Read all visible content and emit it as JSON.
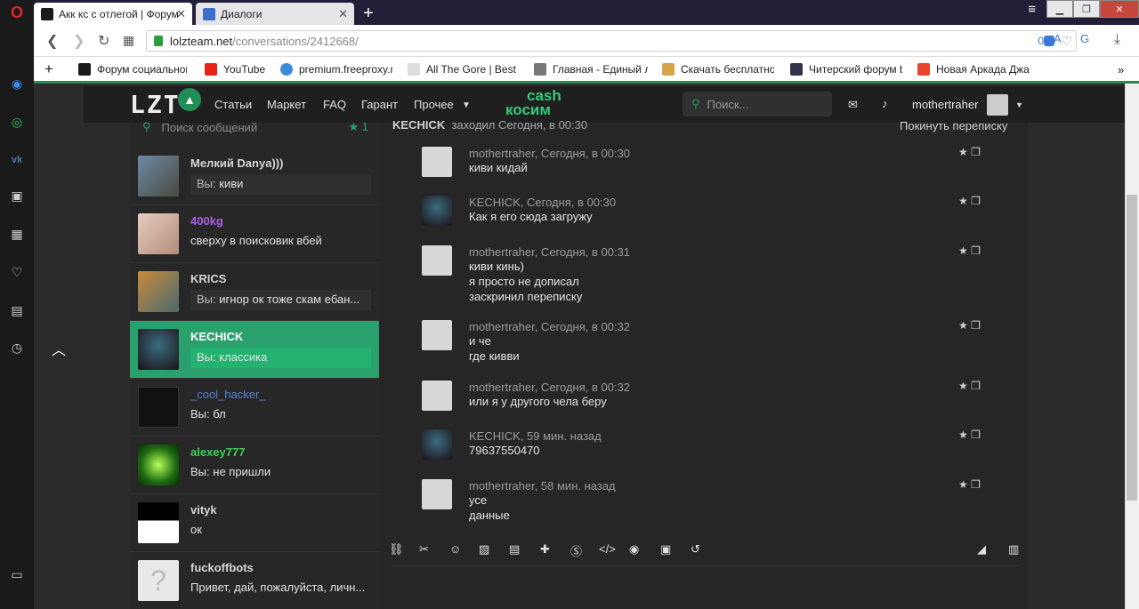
{
  "browser": {
    "tabs": [
      {
        "title": "Акк кс с отлегой | Форум"
      },
      {
        "title": "Диалоги"
      }
    ],
    "address": {
      "domain": "lolzteam.net",
      "path": "/conversations/2412668/",
      "badge_count": "0"
    },
    "bookmarks": [
      {
        "label": "Форум социальной"
      },
      {
        "label": "YouTube"
      },
      {
        "label": "premium.freeproxy.r"
      },
      {
        "label": "All The Gore | Best G"
      },
      {
        "label": "Главная - Единый л"
      },
      {
        "label": "Скачать бесплатно"
      },
      {
        "label": "Читерский форум b"
      },
      {
        "label": "Новая Аркада Джа"
      }
    ]
  },
  "site": {
    "logo": "LZT",
    "nav": [
      "Статьи",
      "Маркет",
      "FAQ",
      "Гарант",
      "Прочее"
    ],
    "cash_logo": [
      "cash",
      "косим"
    ],
    "search_placeholder": "Поиск...",
    "username": "mothertraher"
  },
  "conversations": {
    "search_placeholder": "Поиск сообщений",
    "items": [
      {
        "name": "Мелкий Danya)))",
        "preview_prefix": "Вы:",
        "preview": "киви",
        "name_color": "#d6d6d6"
      },
      {
        "name": "400kg",
        "preview_prefix": "",
        "preview": "сверху в поисковик вбей",
        "name_color": "#b15de6"
      },
      {
        "name": "KRICS",
        "preview_prefix": "Вы:",
        "preview": "игнор ок тоже скам ебан...",
        "name_color": "#d6d6d6"
      },
      {
        "name": "KECHICK",
        "preview_prefix": "Вы:",
        "preview": "классика",
        "name_color": "#ffffff"
      },
      {
        "name": "_cool_hacker_",
        "preview_prefix": "Вы:",
        "preview": "бл",
        "name_color": "#5a7fd0"
      },
      {
        "name": "alexey777",
        "preview_prefix": "Вы:",
        "preview": "не пришли",
        "name_color": "#3fd05a"
      },
      {
        "name": "vityk",
        "preview_prefix": "",
        "preview": "ок",
        "name_color": "#d6d6d6"
      },
      {
        "name": "fuckoffbots",
        "preview_prefix": "",
        "preview": "Привет, дай, пожалуйста, личн...",
        "name_color": "#d6d6d6"
      }
    ]
  },
  "dialog": {
    "partner": "KECHICK",
    "status": "заходил Сегодня, в 00:30",
    "leave_label": "Покинуть переписку",
    "messages": [
      {
        "meta": "mothertraher, Сегодня, в 00:30",
        "lines": [
          "киви кидай"
        ],
        "author": "me"
      },
      {
        "meta": "KECHICK, Сегодня, в 00:30",
        "lines": [
          "Как я его сюда загружу"
        ],
        "author": "them"
      },
      {
        "meta": "mothertraher, Сегодня, в 00:31",
        "lines": [
          "киви кинь)",
          "я просто не дописал",
          "заскринил переписку"
        ],
        "author": "me"
      },
      {
        "meta": "mothertraher, Сегодня, в 00:32",
        "lines": [
          "и че",
          "где кивви"
        ],
        "author": "me"
      },
      {
        "meta": "mothertraher, Сегодня, в 00:32",
        "lines": [
          "или я у другого чела беру"
        ],
        "author": "me"
      },
      {
        "meta": "KECHICK, 59 мин. назад",
        "lines": [
          "79637550470"
        ],
        "author": "them"
      },
      {
        "meta": "mothertraher, 58 мин. назад",
        "lines": [
          "усе",
          "данные"
        ],
        "author": "me"
      }
    ]
  },
  "colors": {
    "accent": "#2aa16c",
    "page_bg": "#2b2b2b",
    "header_bg": "#1f1f1f"
  }
}
